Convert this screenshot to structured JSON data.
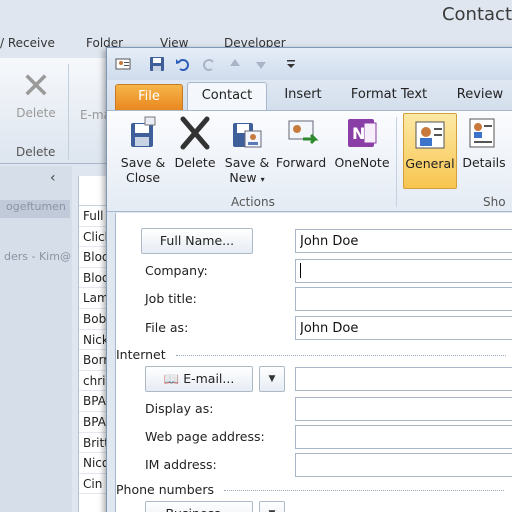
{
  "background_window": {
    "title": "Contact",
    "tabs": [
      "/ Receive",
      "Folder",
      "View",
      "Developer"
    ],
    "delete_button": "Delete",
    "email_button": "E-ma",
    "group_label": "Delete",
    "nav_item_1": "ogeftumen",
    "nav_item_2": "ders - Kim@",
    "list_rows": [
      "Full",
      "Click",
      "Bloc",
      "Bloc",
      "Lam",
      "Bob",
      "Nick",
      "Borr",
      "chri",
      "BPA",
      "BPA",
      "Britt",
      "Nico",
      "Cin"
    ]
  },
  "qat": {
    "icons": [
      "contact-window-icon",
      "save-icon",
      "undo-icon",
      "redo-icon",
      "up-arrow-icon",
      "down-arrow-icon",
      "customize-qat-icon"
    ]
  },
  "tabs": {
    "file": "File",
    "contact": "Contact",
    "insert": "Insert",
    "format_text": "Format Text",
    "review": "Review"
  },
  "ribbon": {
    "save_close_1": "Save &",
    "save_close_2": "Close",
    "delete": "Delete",
    "save_new_1": "Save &",
    "save_new_2": "New",
    "forward": "Forward",
    "onenote": "OneNote",
    "general": "General",
    "details": "Details",
    "group_actions": "Actions",
    "group_show": "Sho"
  },
  "form": {
    "full_name_button": "Full Name...",
    "full_name_value": "John Doe",
    "company_label": "Company:",
    "company_value": "",
    "job_title_label": "Job title:",
    "job_title_value": "",
    "file_as_label": "File as:",
    "file_as_value": "John Doe",
    "internet_section": "Internet",
    "email_button": "E-mail...",
    "email_value": "",
    "display_as_label": "Display as:",
    "display_as_value": "",
    "web_page_label": "Web page address:",
    "web_page_value": "",
    "im_label": "IM address:",
    "im_value": "",
    "phone_section": "Phone numbers",
    "business_button": "Business..."
  },
  "colors": {
    "file_tab": "#e8871f",
    "general_selected": "#f7c550",
    "window_border": "#7f98b8"
  }
}
